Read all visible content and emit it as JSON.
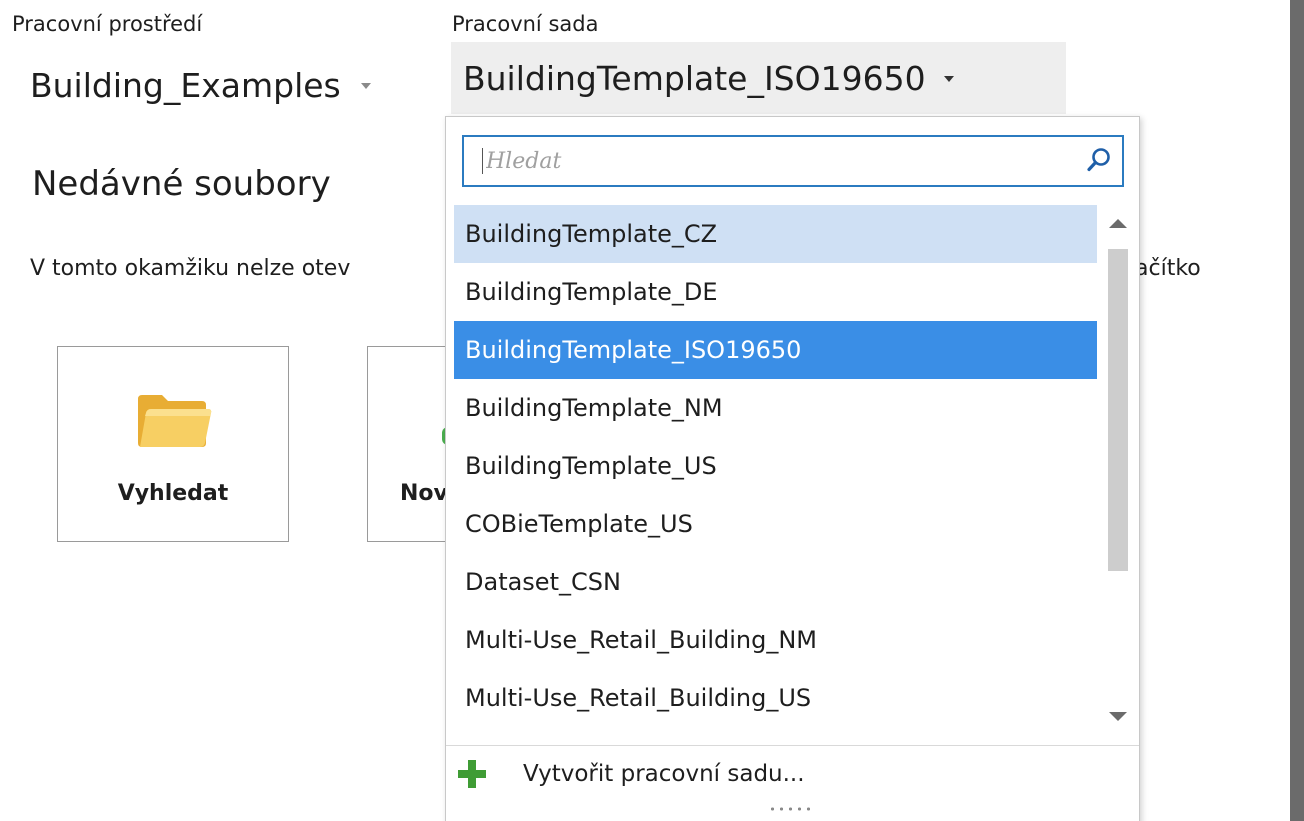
{
  "workspace": {
    "label": "Pracovní prostředí",
    "value": "Building_Examples"
  },
  "workset": {
    "label": "Pracovní sada",
    "value": "BuildingTemplate_ISO19650"
  },
  "recent": {
    "heading": "Nedávné soubory",
    "info_left": "V tomto okamžiku nelze otev",
    "info_right": "e na tlačítko"
  },
  "tiles": {
    "browse_label": "Vyhledat",
    "new_label": "Nov"
  },
  "dropdown": {
    "search_placeholder": "Hledat",
    "search_value": "",
    "items": [
      "BuildingTemplate_CZ",
      "BuildingTemplate_DE",
      "BuildingTemplate_ISO19650",
      "BuildingTemplate_NM",
      "BuildingTemplate_US",
      "COBieTemplate_US",
      "Dataset_CSN",
      "Multi-Use_Retail_Building_NM",
      "Multi-Use_Retail_Building_US"
    ],
    "hover_index": 0,
    "selected_index": 2,
    "create_label": "Vytvořit pracovní sadu..."
  },
  "colors": {
    "accent": "#3a8ee6",
    "hover": "#cfe0f4",
    "search_border": "#2b7bc0",
    "plus": "#3f9c35",
    "folder": "#f5c451"
  },
  "icons": [
    "caret-down-icon",
    "search-icon",
    "folder-icon",
    "plus-icon",
    "resize-grip-icon"
  ]
}
